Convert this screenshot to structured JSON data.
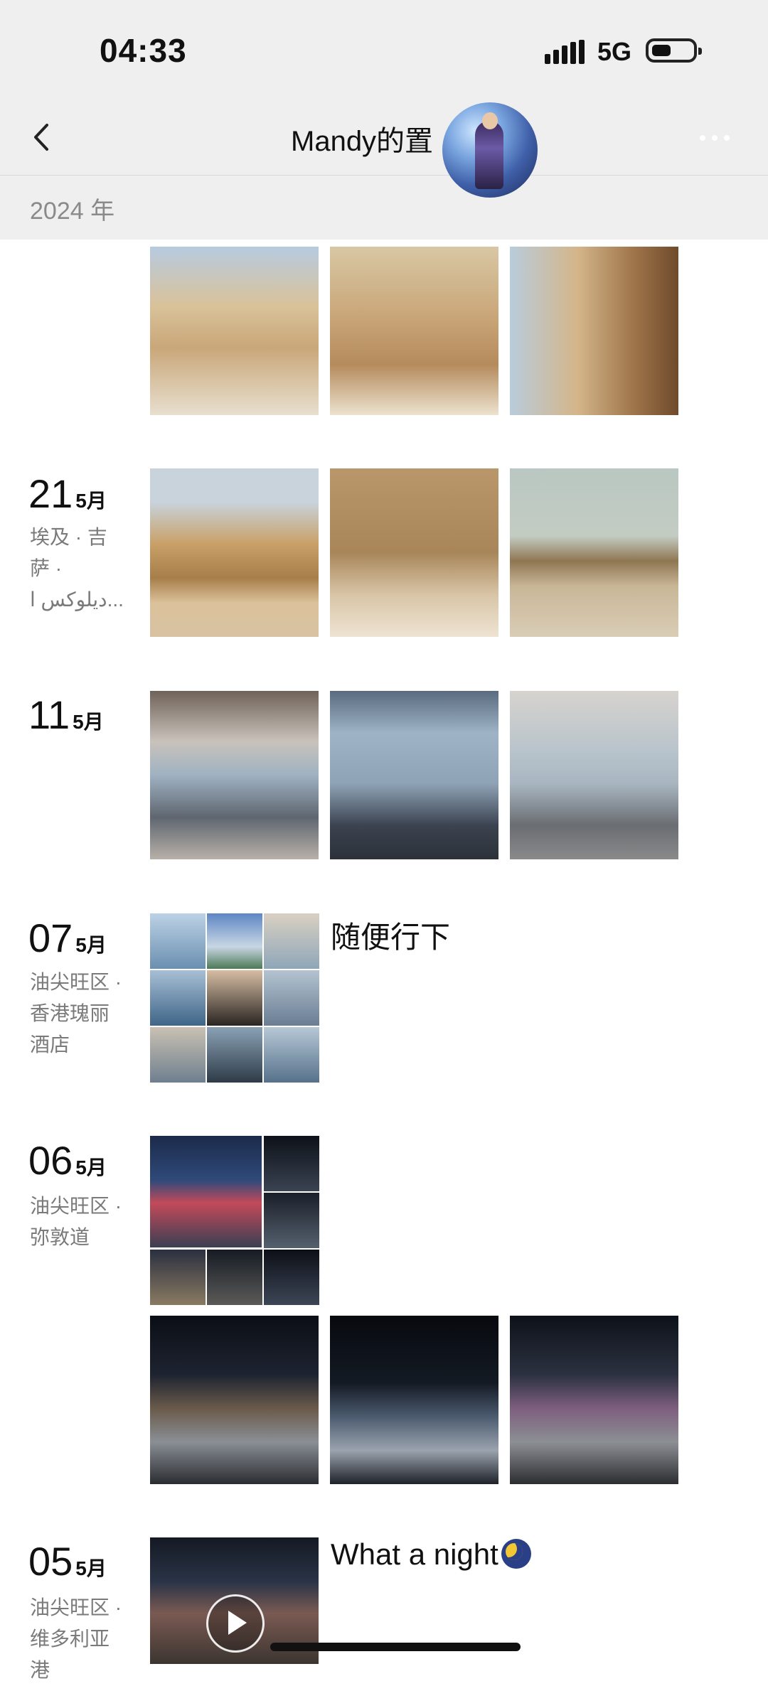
{
  "status_bar": {
    "time": "04:33",
    "network": "5G"
  },
  "header": {
    "title": "Mandy的置"
  },
  "year_label": "2024 年",
  "entries": [
    {
      "day": "21",
      "month": "5月",
      "location": [
        "埃及 · 吉",
        "萨 ·",
        "ديلوكس ا..."
      ]
    },
    {
      "day": "11",
      "month": "5月"
    },
    {
      "day": "07",
      "month": "5月",
      "location": [
        "油尖旺区 ·",
        "香港瑰丽",
        "酒店"
      ],
      "caption": "随便行下"
    },
    {
      "day": "06",
      "month": "5月",
      "location": [
        "油尖旺区 ·",
        "弥敦道"
      ]
    },
    {
      "day": "05",
      "month": "5月",
      "location": [
        "油尖旺区 ·",
        "维多利亚",
        "港"
      ],
      "caption": "What a night"
    }
  ],
  "colors": {
    "bar_bg": "#efefef",
    "muted_text": "#7a7a7a"
  }
}
